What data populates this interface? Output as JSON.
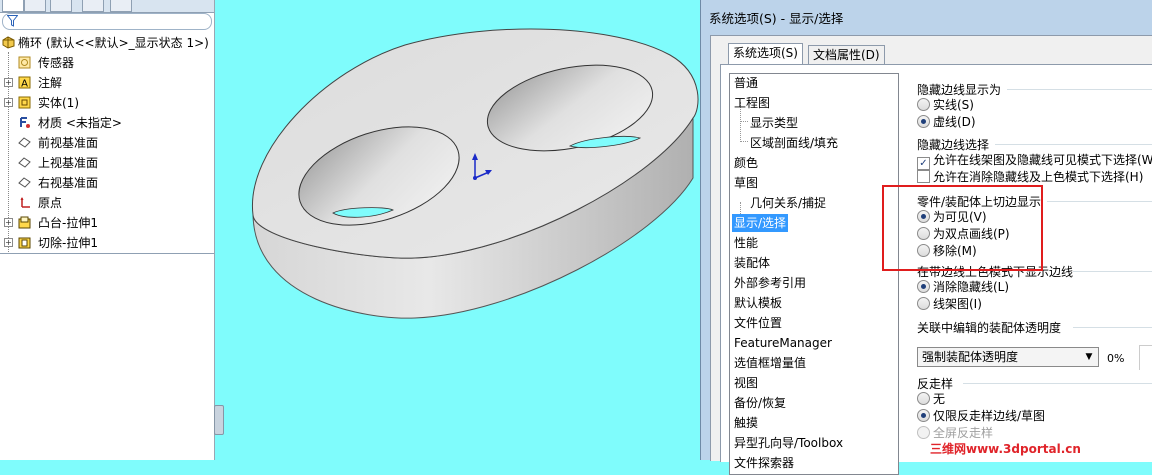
{
  "tree": {
    "filter_icon": "funnel-icon",
    "items": [
      {
        "label": "椭环  (默认<<默认>_显示状态 1>)",
        "icon": "part-icon",
        "expander": "minus"
      },
      {
        "label": "传感器",
        "icon": "sensor-icon"
      },
      {
        "label": "注解",
        "icon": "annotation-icon",
        "expander": "plus"
      },
      {
        "label": "实体(1)",
        "icon": "solid-body-icon",
        "expander": "plus"
      },
      {
        "label": "材质 <未指定>",
        "icon": "material-icon"
      },
      {
        "label": "前视基准面",
        "icon": "plane-icon"
      },
      {
        "label": "上视基准面",
        "icon": "plane-icon"
      },
      {
        "label": "右视基准面",
        "icon": "plane-icon"
      },
      {
        "label": "原点",
        "icon": "origin-icon"
      },
      {
        "label": "凸台-拉伸1",
        "icon": "extrude-boss-icon",
        "expander": "plus"
      },
      {
        "label": "切除-拉伸1",
        "icon": "extrude-cut-icon",
        "expander": "plus"
      }
    ]
  },
  "dialog": {
    "title": "系统选项(S) - 显示/选择",
    "tabs": [
      {
        "label": "系统选项(S)",
        "active": true
      },
      {
        "label": "文档属性(D)",
        "active": false
      }
    ],
    "categories": [
      {
        "label": "普通",
        "level": 0
      },
      {
        "label": "工程图",
        "level": 0
      },
      {
        "label": "显示类型",
        "level": 1
      },
      {
        "label": "区域剖面线/填充",
        "level": 1
      },
      {
        "label": "颜色",
        "level": 0
      },
      {
        "label": "草图",
        "level": 0
      },
      {
        "label": "几何关系/捕捉",
        "level": 1
      },
      {
        "label": "显示/选择",
        "level": 0,
        "selected": true
      },
      {
        "label": "性能",
        "level": 0
      },
      {
        "label": "装配体",
        "level": 0
      },
      {
        "label": "外部参考引用",
        "level": 0
      },
      {
        "label": "默认模板",
        "level": 0
      },
      {
        "label": "文件位置",
        "level": 0
      },
      {
        "label": "FeatureManager",
        "level": 0
      },
      {
        "label": "选值框增量值",
        "level": 0
      },
      {
        "label": "视图",
        "level": 0
      },
      {
        "label": "备份/恢复",
        "level": 0
      },
      {
        "label": "触摸",
        "level": 0
      },
      {
        "label": "异型孔向导/Toolbox",
        "level": 0
      },
      {
        "label": "文件探索器",
        "level": 0
      }
    ],
    "groups": {
      "hidden_edges_display": {
        "title": "隐藏边线显示为",
        "options": [
          {
            "label": "实线(S)",
            "checked": false
          },
          {
            "label": "虚线(D)",
            "checked": true
          }
        ]
      },
      "hidden_edges_select": {
        "title": "隐藏边线选择",
        "options": [
          {
            "label": "允许在线架图及隐藏线可见模式下选择(W)",
            "checked": true
          },
          {
            "label": "允许在消除隐藏线及上色模式下选择(H)",
            "checked": false
          }
        ]
      },
      "tangent_edges": {
        "title": "零件/装配体上切边显示",
        "options": [
          {
            "label": "为可见(V)",
            "checked": true
          },
          {
            "label": "为双点画线(P)",
            "checked": false
          },
          {
            "label": "移除(M)",
            "checked": false
          }
        ]
      },
      "shaded_edges": {
        "title": "在带边线上色模式下显示边线",
        "options": [
          {
            "label": "消除隐藏线(L)",
            "checked": true
          },
          {
            "label": "线架图(I)",
            "checked": false
          }
        ]
      },
      "assembly_transparency": {
        "title": "关联中编辑的装配体透明度",
        "select_value": "强制装配体透明度",
        "percent": "0%"
      },
      "antialiasing": {
        "title": "反走样",
        "options": [
          {
            "label": "无",
            "checked": false
          },
          {
            "label": "仅限反走样边线/草图",
            "checked": true
          },
          {
            "label": "全屏反走样",
            "checked": false,
            "disabled": true
          }
        ]
      }
    }
  },
  "highlight_color": "#e01d1d",
  "viewport_color": "#7ffcfc",
  "watermark": "三维网www.3dportal.cn"
}
